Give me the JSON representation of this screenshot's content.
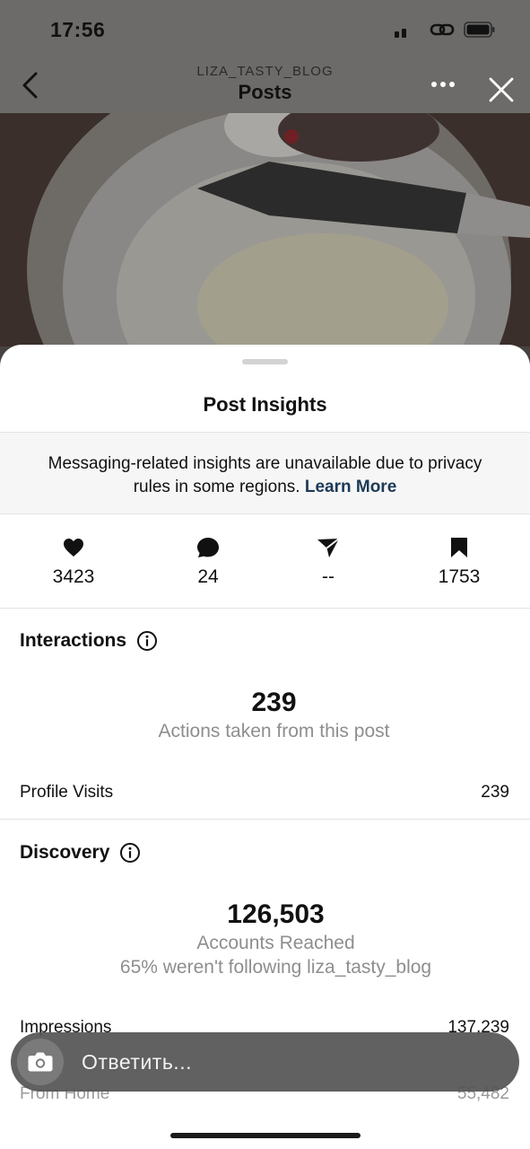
{
  "status_bar": {
    "time": "17:56"
  },
  "header": {
    "account": "LIZA_TASTY_BLOG",
    "title": "Posts"
  },
  "sheet": {
    "title": "Post Insights",
    "notice": {
      "text": "Messaging-related insights are unavailable due to privacy rules in some regions.",
      "link": "Learn More"
    },
    "metrics": [
      {
        "icon": "heart-icon",
        "value": "3423"
      },
      {
        "icon": "comment-icon",
        "value": "24"
      },
      {
        "icon": "share-icon",
        "value": "--"
      },
      {
        "icon": "bookmark-icon",
        "value": "1753"
      }
    ],
    "interactions": {
      "title": "Interactions",
      "total": "239",
      "subtitle": "Actions taken from this post",
      "profile_visits_label": "Profile Visits",
      "profile_visits_value": "239"
    },
    "discovery": {
      "title": "Discovery",
      "total": "126,503",
      "subtitle": "Accounts Reached",
      "note": "65% weren't following liza_tasty_blog",
      "impressions_label": "Impressions",
      "impressions_value": "137,239",
      "from_home_label": "From Home",
      "from_home_value": "55,482"
    }
  },
  "reply": {
    "placeholder": "Ответить..."
  },
  "colors": {
    "link": "#1b3a57",
    "muted": "#8e8e8e",
    "sheet": "#ffffff"
  }
}
